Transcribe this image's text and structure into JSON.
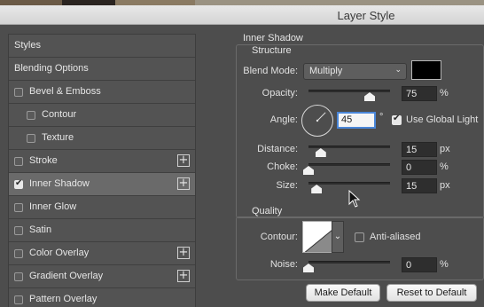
{
  "window": {
    "title": "Layer Style"
  },
  "sidebar": {
    "items": [
      {
        "label": "Styles",
        "checkbox": false,
        "checked": false,
        "plus": false,
        "indent": 0,
        "selected": false
      },
      {
        "label": "Blending Options",
        "checkbox": false,
        "checked": false,
        "plus": false,
        "indent": 0,
        "selected": false
      },
      {
        "label": "Bevel & Emboss",
        "checkbox": true,
        "checked": false,
        "plus": false,
        "indent": 0,
        "selected": false
      },
      {
        "label": "Contour",
        "checkbox": true,
        "checked": false,
        "plus": false,
        "indent": 1,
        "selected": false
      },
      {
        "label": "Texture",
        "checkbox": true,
        "checked": false,
        "plus": false,
        "indent": 1,
        "selected": false
      },
      {
        "label": "Stroke",
        "checkbox": true,
        "checked": false,
        "plus": true,
        "indent": 0,
        "selected": false
      },
      {
        "label": "Inner Shadow",
        "checkbox": true,
        "checked": true,
        "plus": true,
        "indent": 0,
        "selected": true
      },
      {
        "label": "Inner Glow",
        "checkbox": true,
        "checked": false,
        "plus": false,
        "indent": 0,
        "selected": false
      },
      {
        "label": "Satin",
        "checkbox": true,
        "checked": false,
        "plus": false,
        "indent": 0,
        "selected": false
      },
      {
        "label": "Color Overlay",
        "checkbox": true,
        "checked": false,
        "plus": true,
        "indent": 0,
        "selected": false
      },
      {
        "label": "Gradient Overlay",
        "checkbox": true,
        "checked": false,
        "plus": true,
        "indent": 0,
        "selected": false
      },
      {
        "label": "Pattern Overlay",
        "checkbox": true,
        "checked": false,
        "plus": false,
        "indent": 0,
        "selected": false
      }
    ]
  },
  "inner_shadow": {
    "section_title": "Inner Shadow",
    "structure_title": "Structure",
    "blend_mode_label": "Blend Mode:",
    "blend_mode_value": "Multiply",
    "shadow_color": "#000000",
    "opacity_label": "Opacity:",
    "opacity_value": "75",
    "opacity_unit": "%",
    "opacity_fraction": 0.75,
    "angle_label": "Angle:",
    "angle_value": "45",
    "angle_unit": "°",
    "angle_degrees": 45,
    "use_global_light_label": "Use Global Light",
    "use_global_light_checked": true,
    "distance_label": "Distance:",
    "distance_value": "15",
    "distance_unit": "px",
    "distance_fraction": 0.15,
    "choke_label": "Choke:",
    "choke_value": "0",
    "choke_unit": "%",
    "choke_fraction": 0.0,
    "size_label": "Size:",
    "size_value": "15",
    "size_unit": "px",
    "size_fraction": 0.1
  },
  "quality": {
    "title": "Quality",
    "contour_label": "Contour:",
    "anti_aliased_label": "Anti-aliased",
    "anti_aliased_checked": false,
    "noise_label": "Noise:",
    "noise_value": "0",
    "noise_unit": "%",
    "noise_fraction": 0.0
  },
  "buttons": {
    "make_default": "Make Default",
    "reset_to_default": "Reset to Default"
  }
}
